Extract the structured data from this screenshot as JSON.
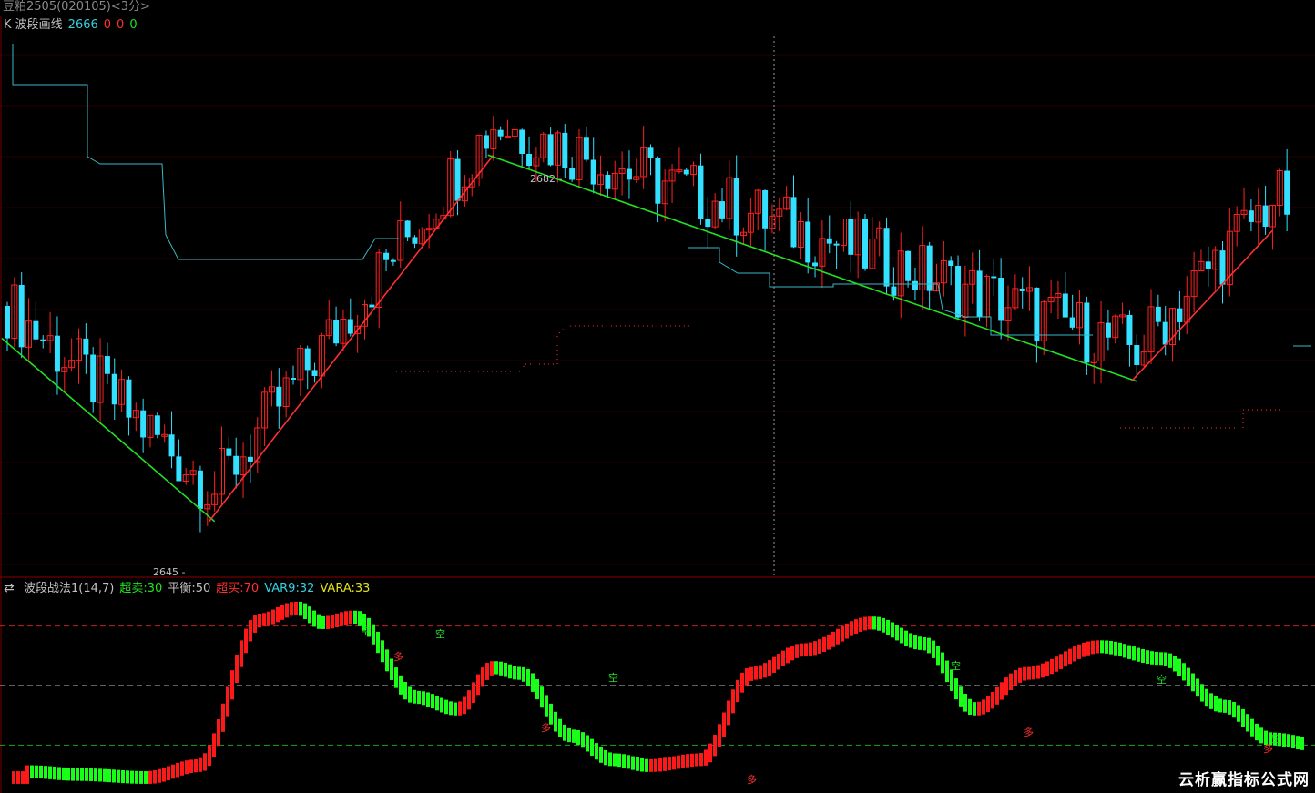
{
  "window": {
    "title": "豆粕2505(020105)<3分>"
  },
  "main_legend": {
    "indicator": "K 波段画线",
    "value": "2666",
    "v2": "0",
    "v3": "0",
    "v4": "0"
  },
  "sub_legend": {
    "icon": "swap-icon",
    "name": "波段战法1(14,7)",
    "oversold": "超卖:30",
    "balance": "平衡:50",
    "overbought": "超买:70",
    "var9": "VAR9:32",
    "vara": "VARA:33"
  },
  "labels": {
    "high": "2682",
    "low": "2645"
  },
  "signals": {
    "sell": "空",
    "buy": "多"
  },
  "watermark": "云析赢指标公式网",
  "colors": {
    "up": "#ff2020",
    "down": "#33e0ff",
    "wave_up": "#ff3030",
    "wave_down": "#22e022",
    "stop_line": "#3ab8c8",
    "support_line": "#ff3030",
    "osc_up": "#ff1818",
    "osc_down": "#18ff18",
    "text_cyan": "#33d0e0",
    "text_red": "#ff3030",
    "text_green": "#22e022",
    "text_yellow": "#e0e020",
    "text_grey": "#c0c0c0"
  },
  "chart_data": {
    "type": "candlestick",
    "title": "豆粕2505(020105)<3分>",
    "price_labels": {
      "high": 2682,
      "low": 2645
    },
    "wave_points": [
      {
        "bar": 0,
        "price": 2662
      },
      {
        "bar": 29,
        "price": 2645
      },
      {
        "bar": 68,
        "price": 2679
      },
      {
        "bar": 158,
        "price": 2658
      },
      {
        "bar": 177,
        "price": 2672
      }
    ],
    "oscillator": {
      "name": "波段战法1(14,7)",
      "levels": {
        "oversold": 30,
        "balance": 50,
        "overbought": 70
      },
      "var9": 32,
      "vara": 33
    }
  }
}
